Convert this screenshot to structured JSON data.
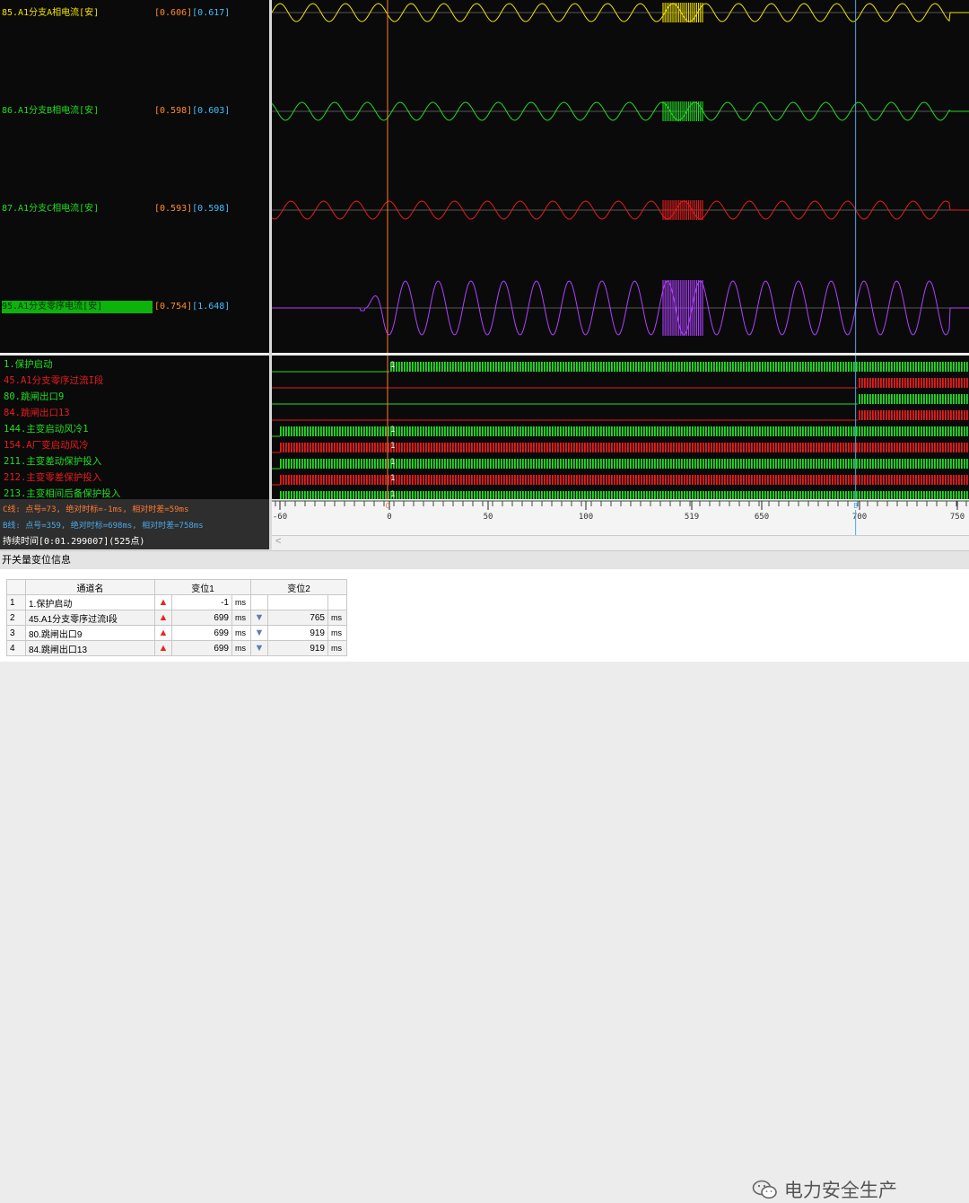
{
  "analog_channels": [
    {
      "label": "85.A1分支A相电流[安]",
      "color": "#f2e200",
      "val1": "[0.606]",
      "val2": "[0.617]",
      "highlighted": false
    },
    {
      "label": "86.A1分支B相电流[安]",
      "color": "#22dd22",
      "val1": "[0.598]",
      "val2": "[0.603]",
      "highlighted": false
    },
    {
      "label": "87.A1分支C相电流[安]",
      "color": "#e81c1c",
      "val1": "[0.593]",
      "val2": "[0.598]",
      "highlighted": false
    },
    {
      "label": "95.A1分支零序电流[安]",
      "color": "#b040ff",
      "val1": "[0.754]",
      "val2": "[1.648]",
      "highlighted": true
    }
  ],
  "digital_channels": [
    {
      "label": "1.保护启动",
      "color": "#22dd22",
      "on_from_ms": 0,
      "on_to_ms": null,
      "mark": "1"
    },
    {
      "label": "45.A1分支零序过流I段",
      "color": "#e81c1c",
      "on_from_ms": 699,
      "on_to_ms": null,
      "mark": ""
    },
    {
      "label": "80.跳闸出口9",
      "color": "#22dd22",
      "on_from_ms": 699,
      "on_to_ms": null,
      "mark": ""
    },
    {
      "label": "84.跳闸出口13",
      "color": "#e81c1c",
      "on_from_ms": 699,
      "on_to_ms": null,
      "mark": ""
    },
    {
      "label": "144.主变启动风冷1",
      "color": "#22dd22",
      "on_from_ms": -60,
      "on_to_ms": null,
      "mark": "1"
    },
    {
      "label": "154.A厂变启动风冷",
      "color": "#e81c1c",
      "on_from_ms": -60,
      "on_to_ms": null,
      "mark": "1"
    },
    {
      "label": "211.主变差动保护投入",
      "color": "#22dd22",
      "on_from_ms": -60,
      "on_to_ms": null,
      "mark": "1"
    },
    {
      "label": "212.主变零差保护投入",
      "color": "#e81c1c",
      "on_from_ms": -60,
      "on_to_ms": null,
      "mark": "1"
    },
    {
      "label": "213.主变相间后备保护投入",
      "color": "#22dd22",
      "on_from_ms": -60,
      "on_to_ms": null,
      "mark": "1"
    }
  ],
  "cursor": {
    "c_line": "C线: 点号=73, 绝对时标=-1ms, 相对时差=59ms",
    "b_line": "B线: 点号=359, 绝对时标=698ms, 相对时差=758ms",
    "duration": "持续时间[0:01.299007](525点)",
    "c_time_ms": -1,
    "b_time_ms": 698,
    "c_color": "#ff7a30",
    "b_color": "#4aa8e8"
  },
  "axis": {
    "ticks": [
      "-60",
      "0",
      "50",
      "100",
      "519",
      "650",
      "700",
      "750"
    ],
    "c_marker": "C",
    "b_marker": "B"
  },
  "scroll_arrow": "<",
  "section_title": "开关量变位信息",
  "table": {
    "headers": [
      "通道名",
      "变位1",
      "变位2"
    ],
    "rows": [
      {
        "no": "1",
        "name": "1.保护启动",
        "d1": "-1",
        "u1": "ms",
        "dir1": "up",
        "d2": "",
        "u2": "",
        "dir2": ""
      },
      {
        "no": "2",
        "name": "45.A1分支零序过流I段",
        "d1": "699",
        "u1": "ms",
        "dir1": "up",
        "d2": "765",
        "u2": "ms",
        "dir2": "down"
      },
      {
        "no": "3",
        "name": "80.跳闸出口9",
        "d1": "699",
        "u1": "ms",
        "dir1": "up",
        "d2": "919",
        "u2": "ms",
        "dir2": "down"
      },
      {
        "no": "4",
        "name": "84.跳闸出口13",
        "d1": "699",
        "u1": "ms",
        "dir1": "up",
        "d2": "919",
        "u2": "ms",
        "dir2": "down"
      }
    ]
  },
  "watermark": "电力安全生产",
  "watermark_icon": "wechat-icon"
}
